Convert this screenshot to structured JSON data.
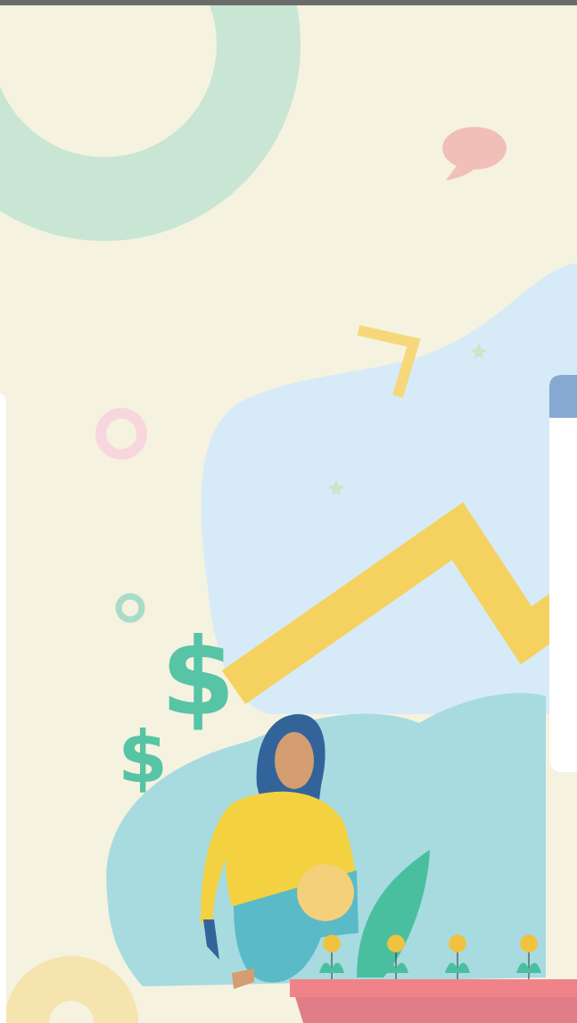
{
  "scene": {
    "kind": "growth-illustration"
  },
  "symbols": [
    "$",
    "$"
  ]
}
